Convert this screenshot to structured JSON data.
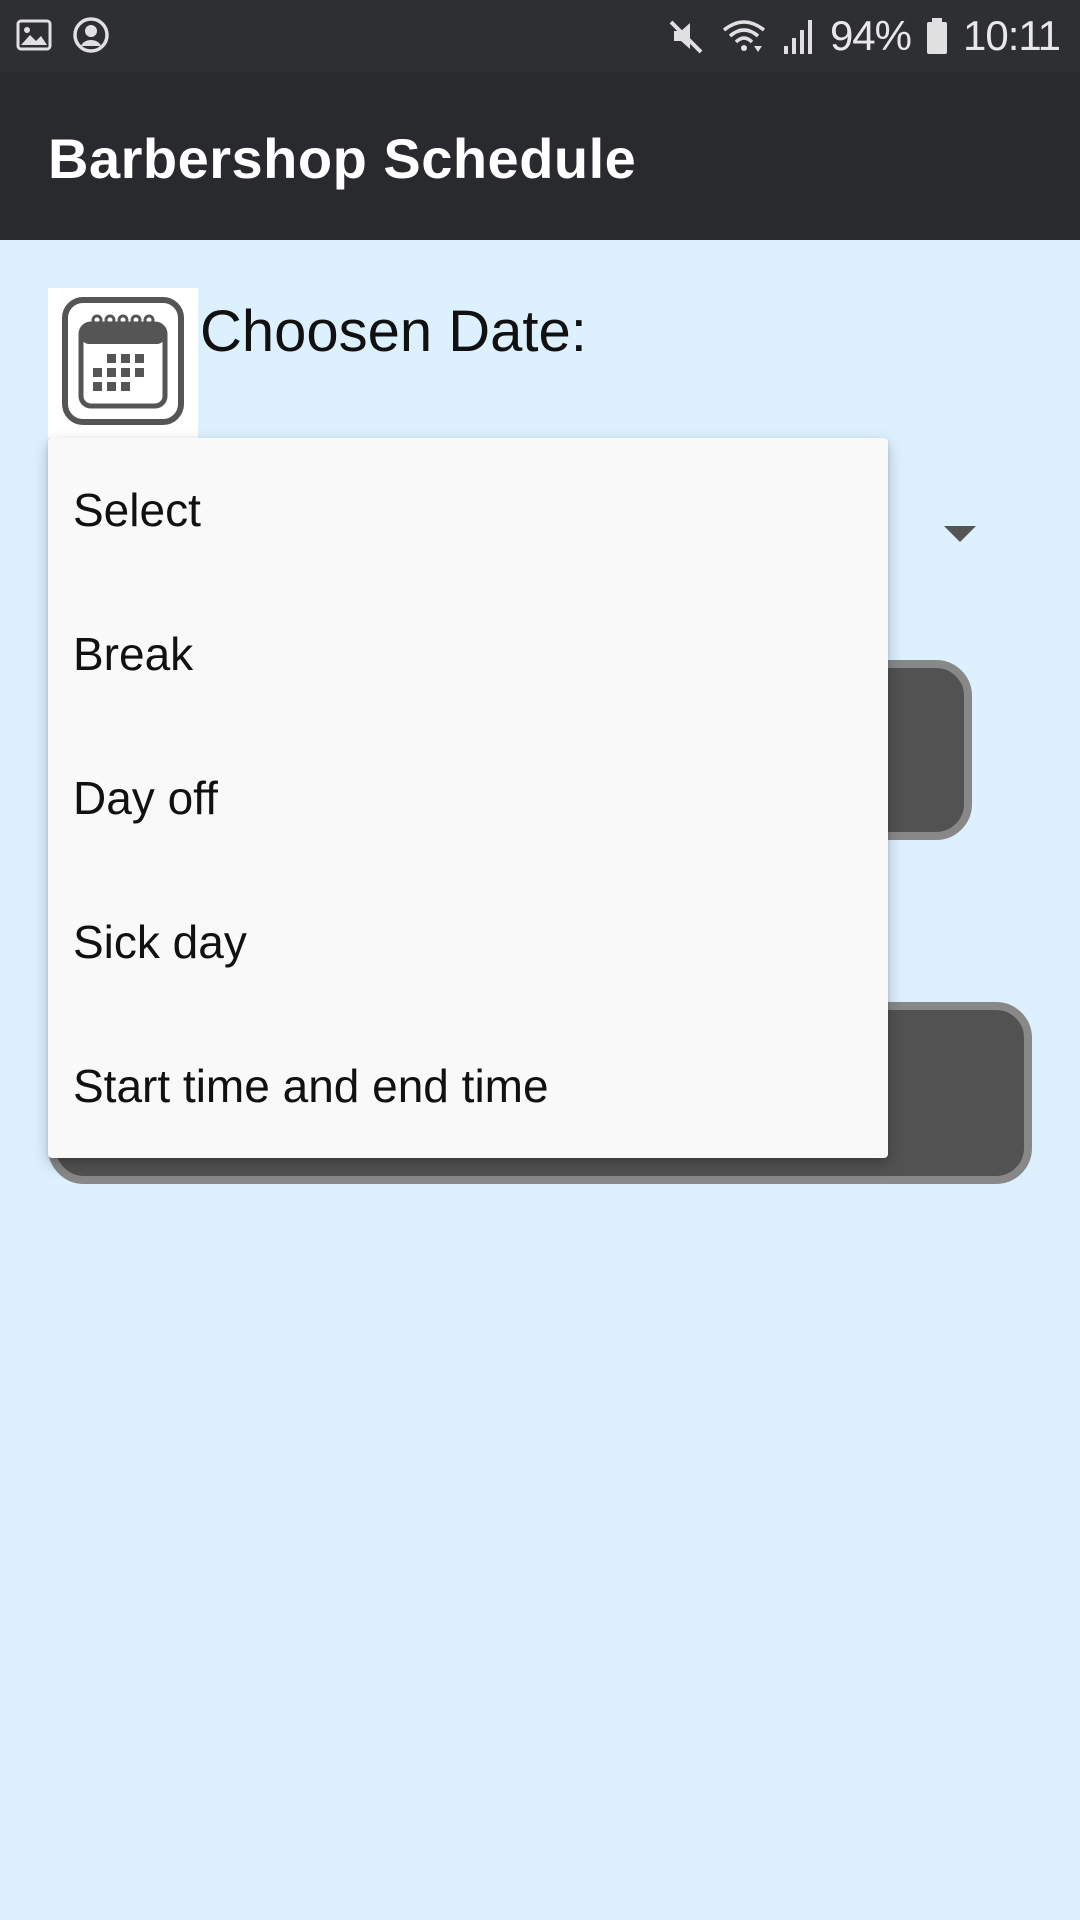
{
  "status_bar": {
    "icons_left": [
      "image-icon",
      "account-circle-icon"
    ],
    "icons_right": [
      "mute-icon",
      "wifi-icon",
      "signal-icon",
      "battery-icon"
    ],
    "battery": "94%",
    "time": "10:11"
  },
  "app_bar": {
    "title": "Barbershop Schedule"
  },
  "main": {
    "calendar_icon": "calendar-icon",
    "date_label": "Choosen Date:"
  },
  "dropdown": {
    "options": [
      "Select",
      "Break",
      "Day off",
      "Sick day",
      "Start time and end time"
    ]
  },
  "colors": {
    "status_bar": "#2e2f33",
    "app_bar": "#292a2e",
    "background": "#dcf0fe",
    "button_fill": "#525252",
    "button_border": "#888888",
    "dropdown_bg": "#f9f9f9"
  }
}
